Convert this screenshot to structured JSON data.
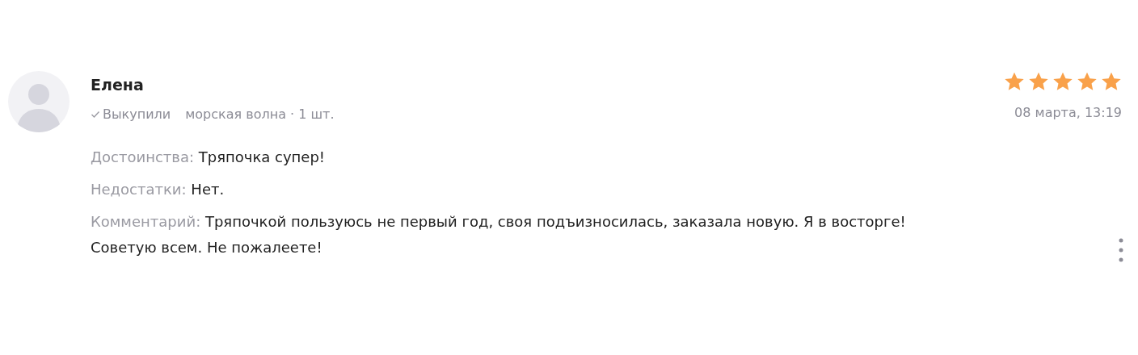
{
  "review": {
    "author": "Елена",
    "purchase_status": {
      "label": "Выкупили",
      "checked": true
    },
    "variant": "морская волна · 1 шт.",
    "stars": 5,
    "date": "08 марта, 13:19",
    "fields": [
      {
        "label": "Достоинства:",
        "value": "Тряпочка супер!"
      },
      {
        "label": "Недостатки:",
        "value": "Нет."
      },
      {
        "label": "Комментарий:",
        "value": "Тряпочкой пользуюсь не первый год, своя подъизносилась, заказала новую. Я в восторге! Советую всем. Не пожалеете!"
      }
    ]
  }
}
